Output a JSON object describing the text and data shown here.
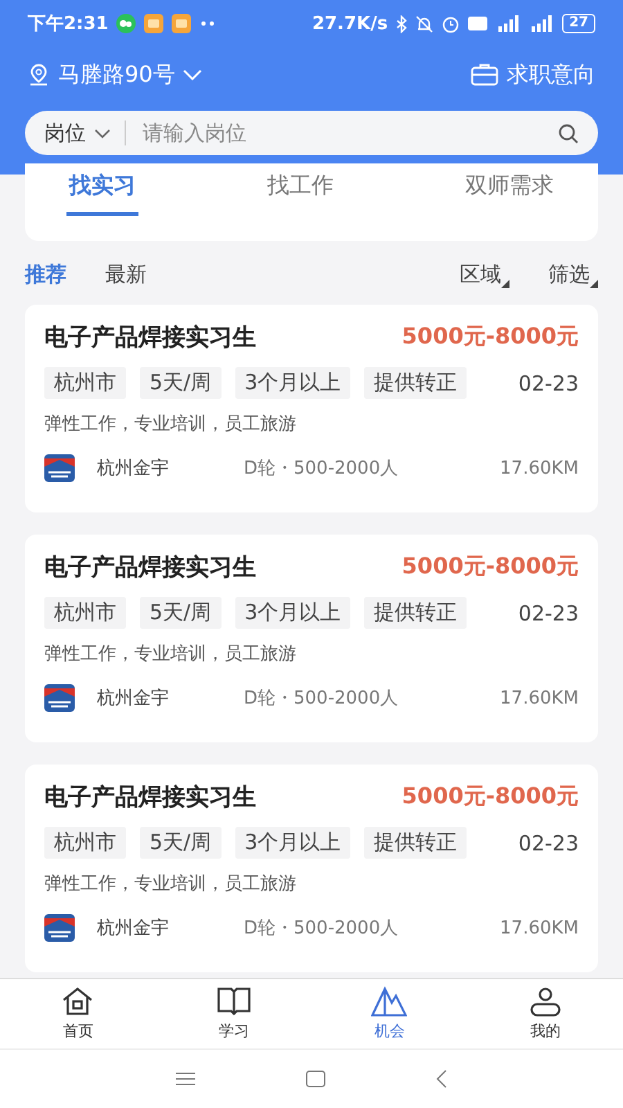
{
  "status_bar": {
    "time": "下午2:31",
    "speed": "27.7K/s",
    "battery": "27"
  },
  "location": {
    "label": "马塍路90号"
  },
  "intent_button": {
    "label": "求职意向"
  },
  "search": {
    "category": "岗位",
    "placeholder": "请输入岗位"
  },
  "tabs": [
    {
      "label": "找实习",
      "selected": true
    },
    {
      "label": "找工作",
      "selected": false
    },
    {
      "label": "双师需求",
      "selected": false
    }
  ],
  "sort_options": [
    {
      "label": "推荐",
      "selected": true
    },
    {
      "label": "最新",
      "selected": false
    }
  ],
  "filters": [
    "区域",
    "筛选"
  ],
  "jobs": [
    {
      "title": "电子产品焊接实习生",
      "salary": "5000元-8000元",
      "tags": [
        "杭州市",
        "5天/周",
        "3个月以上",
        "提供转正"
      ],
      "date": "02-23",
      "benefits": "弹性工作，专业培训，员工旅游",
      "company": "杭州金宇",
      "company_info": "D轮・500-2000人",
      "distance": "17.60KM"
    },
    {
      "title": "电子产品焊接实习生",
      "salary": "5000元-8000元",
      "tags": [
        "杭州市",
        "5天/周",
        "3个月以上",
        "提供转正"
      ],
      "date": "02-23",
      "benefits": "弹性工作，专业培训，员工旅游",
      "company": "杭州金宇",
      "company_info": "D轮・500-2000人",
      "distance": "17.60KM"
    },
    {
      "title": "电子产品焊接实习生",
      "salary": "5000元-8000元",
      "tags": [
        "杭州市",
        "5天/周",
        "3个月以上",
        "提供转正"
      ],
      "date": "02-23",
      "benefits": "弹性工作，专业培训，员工旅游",
      "company": "杭州金宇",
      "company_info": "D轮・500-2000人",
      "distance": "17.60KM"
    }
  ],
  "nav": [
    {
      "label": "首页",
      "selected": false
    },
    {
      "label": "学习",
      "selected": false
    },
    {
      "label": "机会",
      "selected": true
    },
    {
      "label": "我的",
      "selected": false
    }
  ]
}
